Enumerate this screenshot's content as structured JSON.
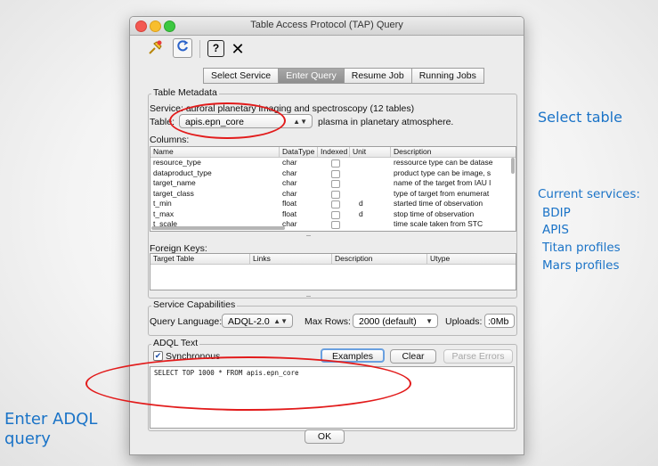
{
  "window": {
    "title": "Table Access Protocol (TAP) Query"
  },
  "toolbar": {
    "icons": [
      "pin-icon",
      "refresh-icon",
      "help-icon",
      "close-icon"
    ],
    "help_glyph": "?",
    "close_glyph": "✕"
  },
  "tabs": [
    "Select Service",
    "Enter Query",
    "Resume Job",
    "Running Jobs"
  ],
  "metadata": {
    "group_label": "Table Metadata",
    "service_line": "Service: auroral planetary imaging and spectroscopy  (12 tables)",
    "table_label": "Table:",
    "table_value": "apis.epn_core",
    "table_desc": "plasma in planetary atmosphere.",
    "columns_label": "Columns:",
    "columns_headers": [
      "Name",
      "DataType",
      "Indexed",
      "Unit",
      "Description"
    ],
    "columns_rows": [
      [
        "resource_type",
        "char",
        "",
        "",
        "ressource type can be datase"
      ],
      [
        "dataproduct_type",
        "char",
        "",
        "",
        "product type can be image, s"
      ],
      [
        "target_name",
        "char",
        "",
        "",
        "name of the target from IAU l"
      ],
      [
        "target_class",
        "char",
        "",
        "",
        "type of target from enumerat"
      ],
      [
        "t_min",
        "float",
        "",
        "d",
        "started time of observation"
      ],
      [
        "t_max",
        "float",
        "",
        "d",
        "stop time of observation"
      ],
      [
        "t_scale",
        "char",
        "",
        "",
        "time scale taken from STC"
      ]
    ],
    "fk_label": "Foreign Keys:",
    "fk_headers": [
      "Target Table",
      "Links",
      "Description",
      "Utype"
    ]
  },
  "capabilities": {
    "group_label": "Service Capabilities",
    "query_language_label": "Query Language:",
    "query_language_value": "ADQL-2.0",
    "max_rows_label": "Max Rows:",
    "max_rows_value": "2000 (default)",
    "uploads_label": "Uploads:",
    "uploads_value": ":0Mb"
  },
  "adql": {
    "group_label": "ADQL Text",
    "synchronous_label": "Synchronous",
    "synchronous_checked": true,
    "examples_label": "Examples",
    "clear_label": "Clear",
    "parse_errors_label": "Parse Errors",
    "query_text": "SELECT TOP 1000 * FROM apis.epn_core"
  },
  "ok_label": "OK",
  "annotations": {
    "select_table": "Select table",
    "current_services_title": "Current services:",
    "services": [
      "BDIP",
      "APIS",
      "Titan  profiles",
      "Mars profiles"
    ],
    "enter_adql": [
      "Enter ADQL",
      "query"
    ]
  },
  "colors": {
    "annotation_text": "#1a73c7",
    "highlight_ellipse": "#e21b1b"
  }
}
